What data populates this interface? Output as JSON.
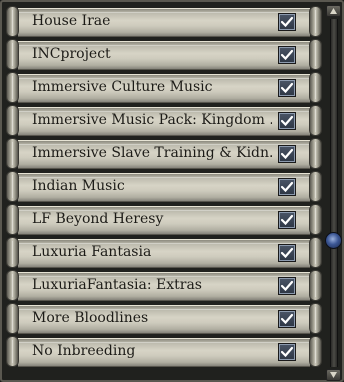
{
  "mods": [
    {
      "label": "House Irae",
      "checked": true
    },
    {
      "label": "INCproject",
      "checked": true
    },
    {
      "label": "Immersive Culture Music",
      "checked": true
    },
    {
      "label": "Immersive Music Pack: Kingdom ...",
      "checked": true
    },
    {
      "label": "Immersive Slave Training & Kidn...",
      "checked": true
    },
    {
      "label": "Indian Music",
      "checked": true
    },
    {
      "label": "LF Beyond Heresy",
      "checked": true
    },
    {
      "label": "Luxuria Fantasia",
      "checked": true
    },
    {
      "label": "LuxuriaFantasia: Extras",
      "checked": true
    },
    {
      "label": "More Bloodlines",
      "checked": true
    },
    {
      "label": "No Inbreeding",
      "checked": true
    }
  ],
  "scrollbar": {
    "position_fraction": 0.64
  },
  "colors": {
    "text": "#1c1b17",
    "checkbox_fill": "#2d3644",
    "checkmark": "#ffffff",
    "thumb": "#3b5694"
  }
}
